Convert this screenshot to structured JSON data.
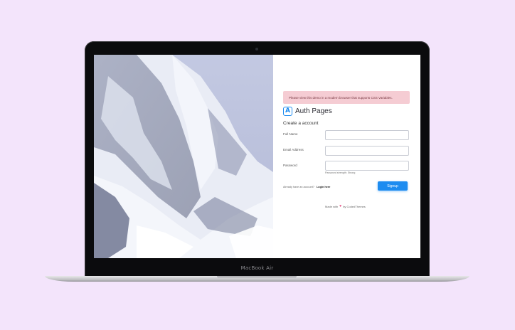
{
  "device": {
    "brand_label": "MacBook Air"
  },
  "auth": {
    "alert_text": "Please view this demo in a modern browser that supports CSS Variables.",
    "logo_mark": "A",
    "logo_text": "Auth Pages",
    "form_title": "Create a account",
    "fields": {
      "full_name": {
        "label": "Full Name",
        "value": "",
        "placeholder": ""
      },
      "email": {
        "label": "Email Address",
        "value": "",
        "placeholder": ""
      },
      "password": {
        "label": "Password",
        "value": "",
        "placeholder": ""
      }
    },
    "password_strength": "Password strength: Strong",
    "account_prompt": "Already have an account?",
    "login_link": "Login here",
    "signup_label": "Signup",
    "footer": {
      "made_with": "Made with",
      "heart": "♥",
      "by": "by CodedThemes"
    }
  },
  "colors": {
    "background": "#f3e4fb",
    "accent": "#1d8cf0",
    "alert_bg": "#f5ccd3",
    "heart": "#e5427a"
  },
  "icons": {
    "logo": "auth-pages-logo-icon",
    "heart": "heart-icon"
  }
}
